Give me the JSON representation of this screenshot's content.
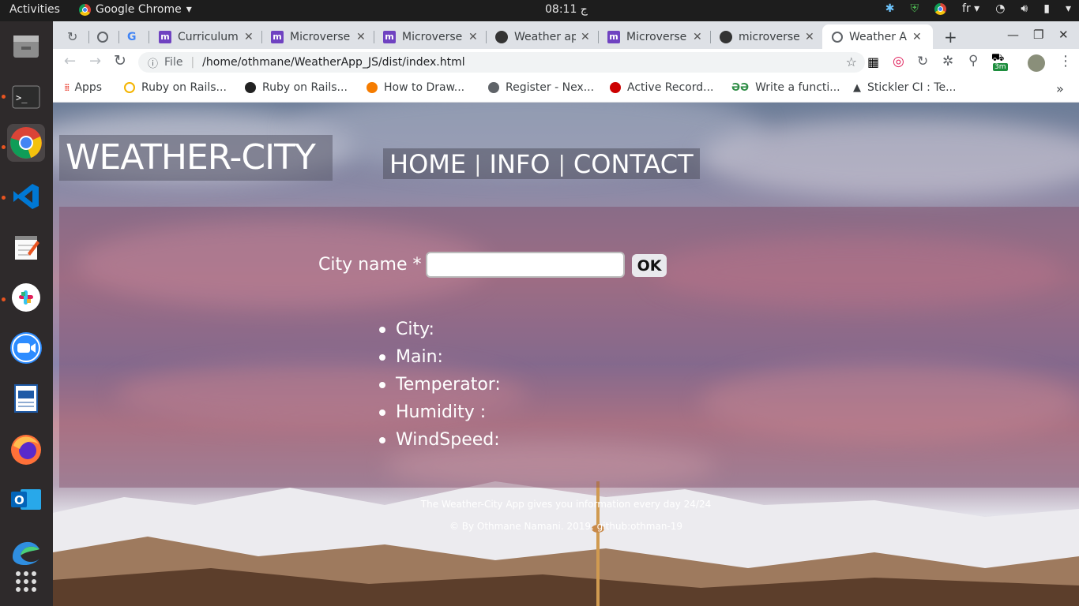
{
  "topbar": {
    "activities": "Activities",
    "app_name": "Google Chrome",
    "clock": "08:11 ج",
    "language": "fr"
  },
  "dock": {
    "items": [
      "files-icon",
      "terminal-icon",
      "chrome-icon",
      "vscode-icon",
      "text-editor-icon",
      "slack-icon",
      "zoom-icon",
      "writer-icon",
      "firefox-icon",
      "outlook-icon",
      "edge-icon",
      "app-grid-icon"
    ]
  },
  "browser": {
    "tabs": [
      {
        "label": "Curriculum"
      },
      {
        "label": "Microverse"
      },
      {
        "label": "Microverse"
      },
      {
        "label": "Weather ap"
      },
      {
        "label": "Microverse"
      },
      {
        "label": "microverse"
      },
      {
        "label": "Weather Ap"
      }
    ],
    "address_scheme": "File",
    "address": "/home/othmane/WeatherApp_JS/dist/index.html",
    "extension_badge": "3m",
    "bookmarks": [
      {
        "label": "Apps"
      },
      {
        "label": "Ruby on Rails..."
      },
      {
        "label": "Ruby on Rails..."
      },
      {
        "label": "How to Draw..."
      },
      {
        "label": "Register - Nex..."
      },
      {
        "label": "Active Record..."
      },
      {
        "label": "Write a functi..."
      },
      {
        "label": "Stickler CI : Te..."
      }
    ],
    "overflow": "»"
  },
  "page": {
    "logo": "WEATHER-CITY",
    "nav": {
      "home": "HOME",
      "separator": "|",
      "info": "INFO",
      "contact": "CONTACT"
    },
    "form": {
      "label": "City name *",
      "value": "",
      "button": "OK"
    },
    "info_items": [
      "City:",
      "Main:",
      "Temperator:",
      "Humidity :",
      "WindSpeed:"
    ],
    "footer": {
      "line1": "The Weather-City App gives you information every day 24/24",
      "line2": "© By Othmane Namani. 2019. github:othman-19"
    }
  }
}
